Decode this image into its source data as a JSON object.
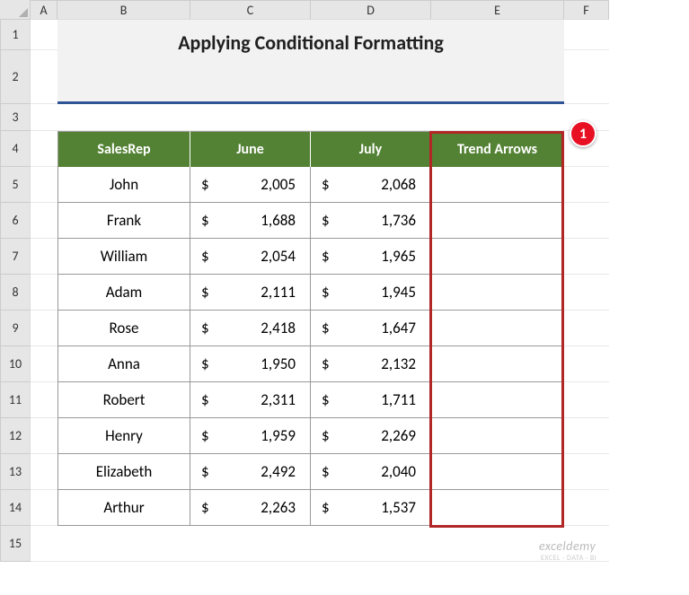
{
  "columns": [
    "A",
    "B",
    "C",
    "D",
    "E",
    "F"
  ],
  "rows": [
    "1",
    "2",
    "3",
    "4",
    "5",
    "6",
    "7",
    "8",
    "9",
    "10",
    "11",
    "12",
    "13",
    "14",
    "15"
  ],
  "title": "Applying Conditional Formatting",
  "headers": {
    "rep": "SalesRep",
    "june": "June",
    "july": "July",
    "trend": "Trend Arrows"
  },
  "currency_symbol": "$",
  "data": [
    {
      "name": "John",
      "june": "2,005",
      "july": "2,068"
    },
    {
      "name": "Frank",
      "june": "1,688",
      "july": "1,736"
    },
    {
      "name": "William",
      "june": "2,054",
      "july": "1,965"
    },
    {
      "name": "Adam",
      "june": "2,111",
      "july": "1,945"
    },
    {
      "name": "Rose",
      "june": "2,418",
      "july": "1,647"
    },
    {
      "name": "Anna",
      "june": "1,950",
      "july": "2,132"
    },
    {
      "name": "Robert",
      "june": "2,311",
      "july": "1,711"
    },
    {
      "name": "Henry",
      "june": "1,959",
      "july": "2,269"
    },
    {
      "name": "Elizabeth",
      "june": "2,492",
      "july": "2,040"
    },
    {
      "name": "Arthur",
      "june": "2,263",
      "july": "1,537"
    }
  ],
  "callout": "1",
  "watermark": "exceldemy",
  "watermark_sub": "EXCEL · DATA · BI"
}
